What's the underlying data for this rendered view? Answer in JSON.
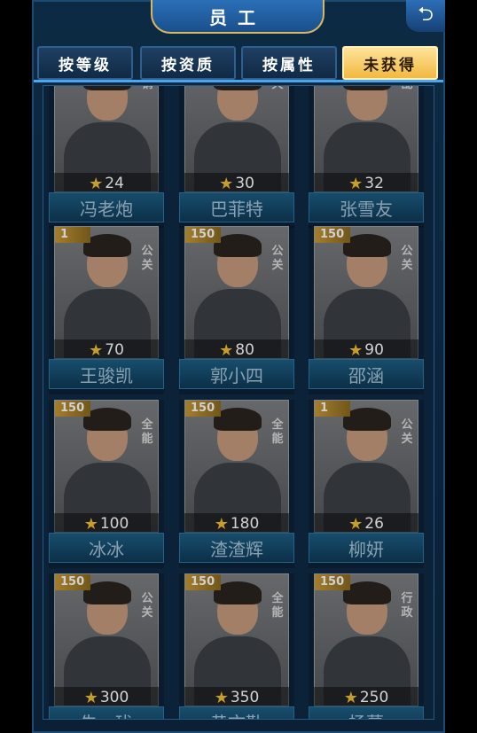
{
  "header": {
    "title": "员工",
    "back_icon": "back-arrow-icon"
  },
  "tabs": [
    {
      "label": "按等级",
      "active": false
    },
    {
      "label": "按资质",
      "active": false
    },
    {
      "label": "按属性",
      "active": false
    },
    {
      "label": "未获得",
      "active": true
    }
  ],
  "employees": [
    {
      "name": "冯老炮",
      "cost": "24",
      "level": "",
      "tag": "销"
    },
    {
      "name": "巴菲特",
      "cost": "30",
      "level": "",
      "tag": "天"
    },
    {
      "name": "张雪友",
      "cost": "32",
      "level": "",
      "tag": "乱"
    },
    {
      "name": "王骏凯",
      "cost": "70",
      "level": "1",
      "tag": "公关"
    },
    {
      "name": "郭小四",
      "cost": "80",
      "level": "150",
      "tag": "公关"
    },
    {
      "name": "邵涵",
      "cost": "90",
      "level": "150",
      "tag": "公关"
    },
    {
      "name": "冰冰",
      "cost": "100",
      "level": "150",
      "tag": "全能"
    },
    {
      "name": "渣渣辉",
      "cost": "180",
      "level": "150",
      "tag": "全能"
    },
    {
      "name": "柳妍",
      "cost": "26",
      "level": "1",
      "tag": "公关"
    },
    {
      "name": "朱一珑",
      "cost": "300",
      "level": "150",
      "tag": "公关"
    },
    {
      "name": "黄文勤",
      "cost": "350",
      "level": "150",
      "tag": "全能"
    },
    {
      "name": "杨蕾",
      "cost": "250",
      "level": "150",
      "tag": "行政"
    }
  ]
}
